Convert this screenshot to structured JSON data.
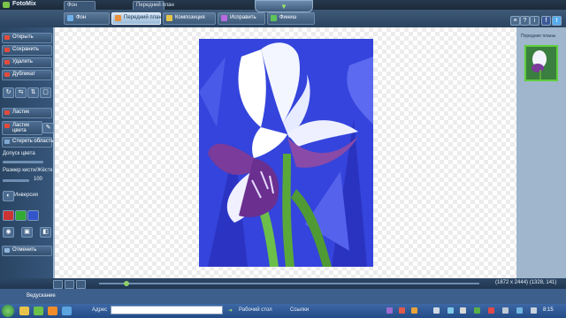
{
  "app": {
    "title": "FotoMix"
  },
  "window_tabs": [
    "Фон",
    "Передний план",
    "Композиция",
    "Исправить",
    "Финиш"
  ],
  "left_panel": {
    "buttons": [
      "Открыть",
      "Сохранить",
      "Удалить",
      "Дубликат"
    ],
    "tool_buttons": [
      "Ластик",
      "Ластик цвета",
      "Стереть область"
    ],
    "labels": {
      "radius": "Допуск цвета",
      "brush_size": "Размер кисти/Жёстк",
      "value": "100",
      "invert": "Инверсия",
      "undo": "Отменить"
    }
  },
  "right_panel": {
    "title": "Передние планы"
  },
  "status": {
    "dimensions": "(1872 x 2444) (1328, 141)"
  },
  "bottom": {
    "label": "Ведускание"
  },
  "taskbar": {
    "address_label": "Адрес",
    "address_value": "",
    "desktop": "Рабочий стол",
    "links": "Ссылки",
    "time": "8:15"
  },
  "colors": {
    "accent": "#2f4b6b",
    "active_tab": "#b9d2ea",
    "photo_bg": "#3344dd"
  }
}
